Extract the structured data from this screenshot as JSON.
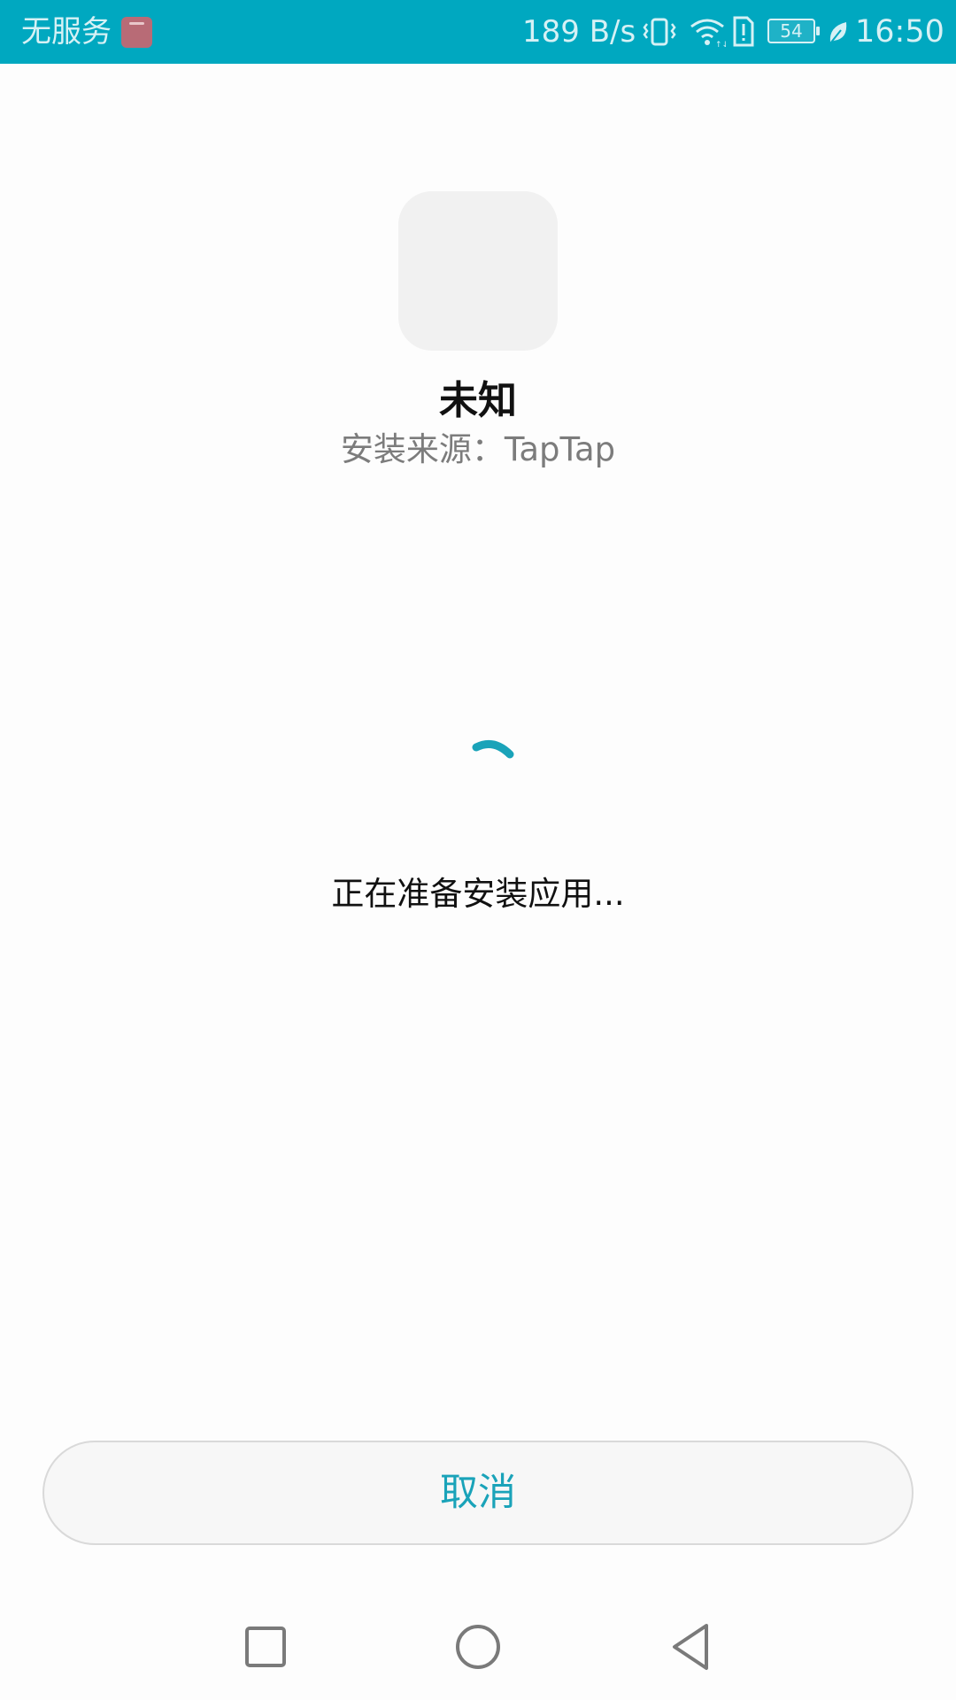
{
  "status_bar": {
    "carrier": "无服务",
    "store_icon": "huawei-appgallery-icon",
    "net_speed": "189 B/s",
    "vibrate_icon": "vibrate-icon",
    "wifi_icon": "wifi-icon",
    "sim_icon": "sim-alert-icon",
    "battery_level": "54",
    "power_saving_icon": "leaf-icon",
    "time": "16:50",
    "background_color": "#00a8c0"
  },
  "app": {
    "icon": "app-placeholder-icon",
    "name": "未知",
    "source": "安装来源：TapTap"
  },
  "progress": {
    "indicator": "loading-spinner",
    "message": "正在准备安装应用...",
    "accent_color": "#1aa3b9"
  },
  "actions": {
    "cancel_label": "取消"
  },
  "nav_bar": {
    "recent_icon": "square-recent-apps-icon",
    "home_icon": "circle-home-icon",
    "back_icon": "triangle-back-icon"
  }
}
